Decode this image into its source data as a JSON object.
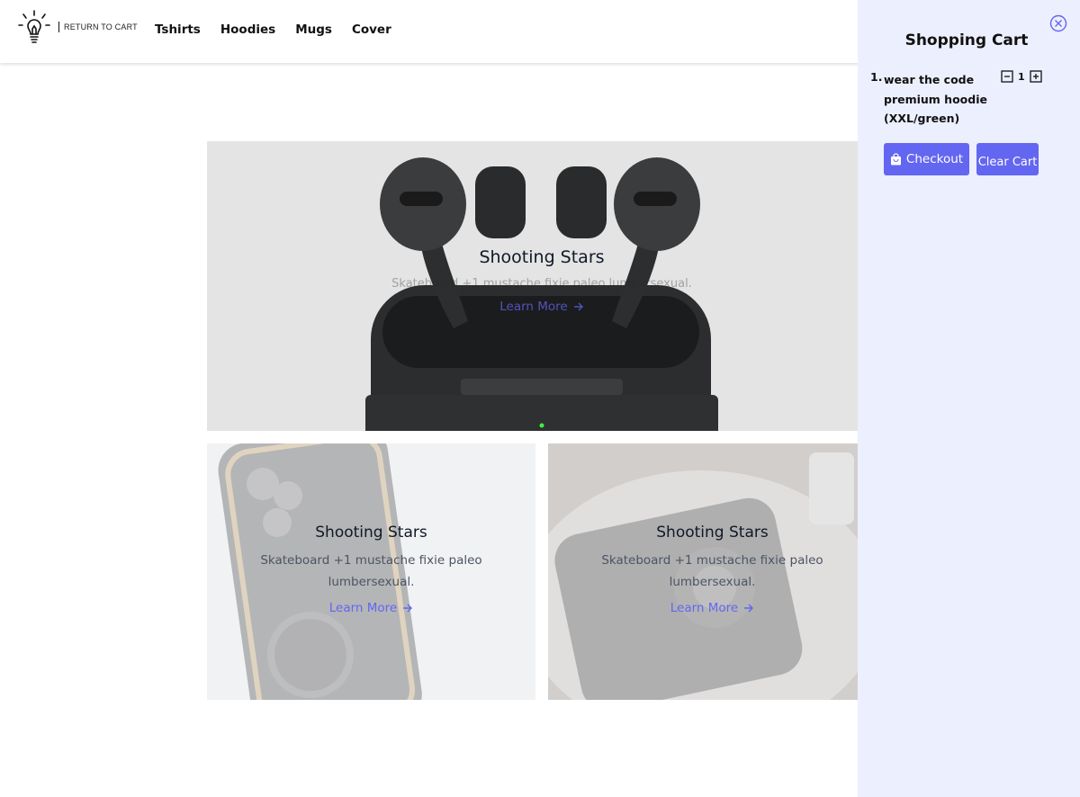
{
  "header": {
    "logo_text": "RETURN TO CART",
    "nav": [
      {
        "label": "Tshirts"
      },
      {
        "label": "Hoodies"
      },
      {
        "label": "Mugs"
      },
      {
        "label": "Cover"
      }
    ]
  },
  "hero": {
    "title": "Shooting Stars",
    "subtitle": "Skateboard +1 mustache fixie paleo lumbersexual.",
    "link": "Learn More",
    "image": "earbuds-case-image"
  },
  "tiles": [
    {
      "title": "Shooting Stars",
      "subtitle_line1": "Skateboard +1 mustache fixie paleo",
      "subtitle_line2": "lumbersexual.",
      "link": "Learn More",
      "image": "phone-case-image"
    },
    {
      "title": "Shooting Stars",
      "subtitle_line1": "Skateboard +1 mustache fixie paleo",
      "subtitle_line2": "lumbersexual.",
      "link": "Learn More",
      "image": "phone-in-hand-image"
    }
  ],
  "cart": {
    "title": "Shopping Cart",
    "items": [
      {
        "number": "1.",
        "name_line1": "wear the code",
        "name_line2": "premium hoodie",
        "name_line3": "(XXL/green)",
        "quantity": "1"
      }
    ],
    "checkout_label": "Checkout",
    "clear_label": "Clear Cart"
  },
  "colors": {
    "accent": "#6366f1",
    "cart_bg": "#eceffe",
    "hero_bg": "#e4e4e4"
  },
  "icons": [
    "bulb-logo-icon",
    "close-circle-icon",
    "minus-square-icon",
    "plus-square-icon",
    "shopping-bag-icon",
    "arrow-right-icon"
  ]
}
